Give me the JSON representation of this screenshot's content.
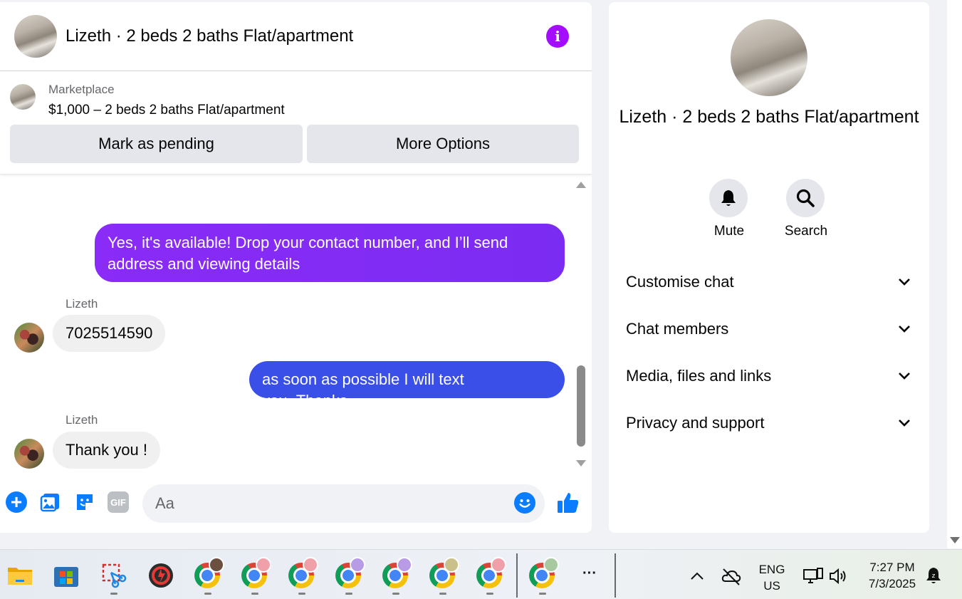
{
  "chat": {
    "title": "Lizeth · 2 beds 2 baths Flat/apartment",
    "marketplace_label": "Marketplace",
    "listing": "$1,000 – 2 beds 2 baths Flat/apartment",
    "mark_pending": "Mark as pending",
    "more_options": "More Options",
    "messages": [
      {
        "from": "me",
        "text": "Yes, it's available! Drop your contact number, and I’ll send address and viewing details"
      },
      {
        "from": "Lizeth",
        "sender": "Lizeth",
        "text": "7025514590"
      },
      {
        "from": "me",
        "text": "as soon as possible I will text you..Thanks"
      },
      {
        "from": "Lizeth",
        "sender": "Lizeth",
        "text": "Thank you !"
      }
    ],
    "composer_placeholder": "Aa",
    "gif_label": "GIF"
  },
  "side": {
    "title": "Lizeth · 2 beds 2 baths Flat/apartment",
    "mute": "Mute",
    "search": "Search",
    "sections": [
      "Customise chat",
      "Chat members",
      "Media, files and links",
      "Privacy and support"
    ]
  },
  "taskbar": {
    "lang1": "ENG",
    "lang2": "US",
    "time": "7:27 PM",
    "date": "7/3/2025",
    "more": "···"
  },
  "colors": {
    "accent": "#0a7cff",
    "info": "#a40dff",
    "bubble_out_1": "#8a2bf7",
    "bubble_out_2": "#3a4fe8"
  }
}
